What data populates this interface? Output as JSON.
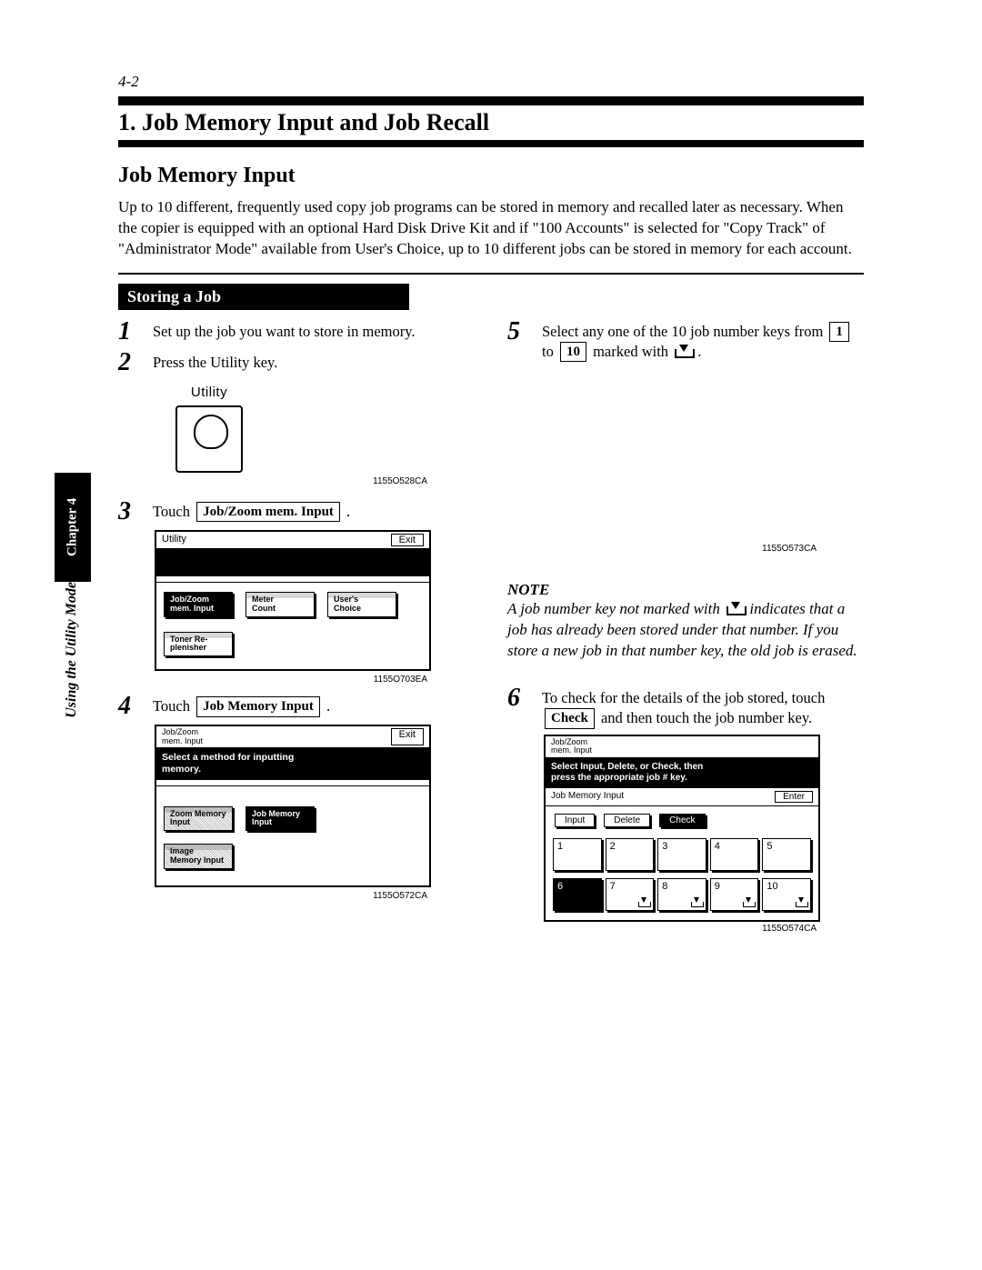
{
  "page_number": "4-2",
  "chapter_tab": "Chapter 4",
  "side_label": "Using the Utility Mode",
  "title": "1. Job Memory Input and Job Recall",
  "subhead": "Job Memory Input",
  "intro": "Up to 10 different, frequently used copy job programs can be stored in memory and recalled later as necessary. When the copier is equipped with an optional Hard Disk Drive Kit and if \"100 Accounts\" is selected for \"Copy Track\" of \"Administrator Mode\" available from User's Choice, up to 10 different jobs can be stored in memory for each account.",
  "section_bar": "Storing a Job",
  "steps": {
    "s1": "Set up the job you want to store in memory.",
    "s2": "Press the Utility key.",
    "s3_a": "Touch ",
    "s3_btn": "Job/Zoom mem. Input",
    "s3_b": " .",
    "s4_a": "Touch ",
    "s4_btn": "Job Memory Input",
    "s4_b": " .",
    "s5_a": "Select any one of the 10 job number keys from ",
    "s5_k1": "1",
    "s5_mid": " to ",
    "s5_k10": "10",
    "s5_b": " marked with ",
    "s5_c": " .",
    "s6_a": "To check for the details of the job stored, touch ",
    "s6_btn": "Check",
    "s6_b": " and then touch the job number key."
  },
  "utility_key_label": "Utility",
  "figcode1": "1155O528CA",
  "figcode2": "1155O703EA",
  "figcode3": "1155O572CA",
  "figcode4": "1155O573CA",
  "figcode5": "1155O574CA",
  "lcd1": {
    "title": "Utility",
    "exit": "Exit",
    "btn1": "Job/Zoom\nmem. Input",
    "btn2": "Meter\nCount",
    "btn3": "User's\nChoice",
    "btn4": "Toner Re-\nplenisher"
  },
  "lcd2": {
    "title": "Job/Zoom\nmem. Input",
    "exit": "Exit",
    "msg": "Select a method for inputting\nmemory.",
    "btn1": "Zoom Memory\nInput",
    "btn2": "Job Memory\nInput",
    "btn3": "Image\nMemory Input"
  },
  "lcd3": {
    "title": "Job/Zoom\nmem. Input",
    "msg": "Select Input, Delete, or Check, then\npress the appropriate job # key.",
    "sub": "Job Memory Input",
    "enter": "Enter",
    "b_input": "Input",
    "b_delete": "Delete",
    "b_check": "Check",
    "nums": [
      "1",
      "2",
      "3",
      "4",
      "5",
      "6",
      "7",
      "8",
      "9",
      "10"
    ],
    "download_keys": [
      7,
      8,
      9,
      10
    ]
  },
  "note": {
    "heading": "NOTE",
    "body_a": "A job number key not marked with ",
    "body_b": " indicates that a job has already been stored under that number.  If you store a new job in that number key, the old job is erased."
  }
}
